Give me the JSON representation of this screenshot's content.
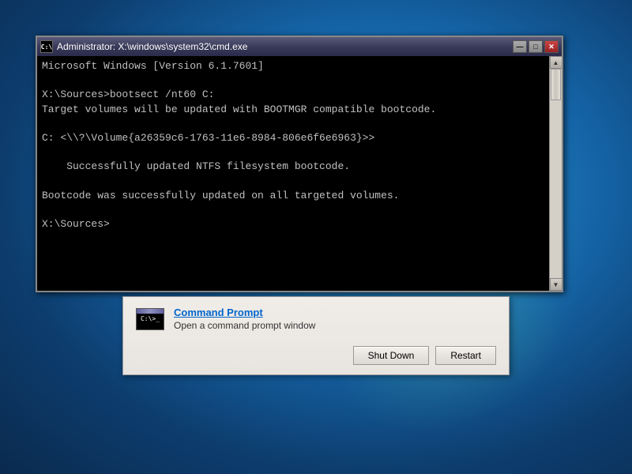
{
  "desktop": {
    "background_color": "#1565a8"
  },
  "cmd_window": {
    "title": "Administrator: X:\\windows\\system32\\cmd.exe",
    "icon_text": "C:\\",
    "controls": {
      "minimize": "—",
      "maximize": "□",
      "close": "✕"
    },
    "content_lines": [
      "Microsoft Windows [Version 6.1.7601]",
      "",
      "X:\\Sources>bootsect /nt60 C:",
      "Target volumes will be updated with BOOTMGR compatible bootcode.",
      "",
      "C: <\\\\?\\Volume{a26359c6-1763-11e6-8984-806e6f6e6963}>",
      "",
      "    Successfully updated NTFS filesystem bootcode.",
      "",
      "Bootcode was successfully updated on all targeted volumes.",
      "",
      "X:\\Sources>"
    ]
  },
  "dialog": {
    "icon_alt": "Command Prompt icon",
    "link_text": "Command Prompt",
    "description": "Open a command prompt window",
    "buttons": {
      "shutdown": "Shut Down",
      "restart": "Restart"
    }
  }
}
